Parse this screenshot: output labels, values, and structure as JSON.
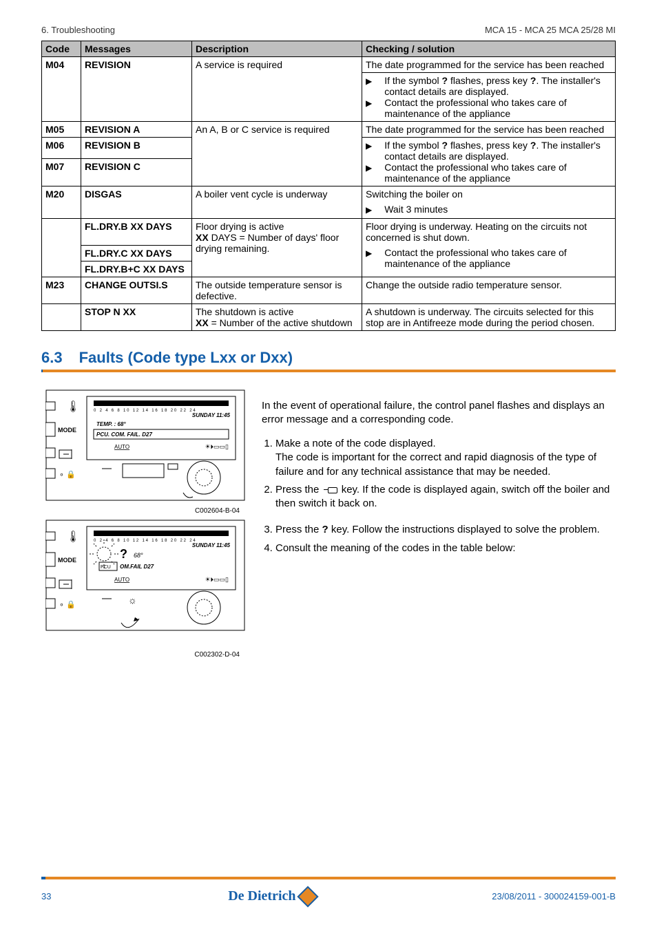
{
  "header": {
    "left": "6. Troubleshooting",
    "right": "MCA 15 - MCA 25 MCA 25/28 MI"
  },
  "table": {
    "headers": {
      "code": "Code",
      "messages": "Messages",
      "description": "Description",
      "checking": "Checking / solution"
    },
    "m04": {
      "code": "M04",
      "msg": "REVISION",
      "desc": "A service is required",
      "chk_main": "The date programmed for the service has been reached",
      "chk_b1a": "If the symbol ",
      "chk_b1b": " flashes, press key ",
      "chk_b1c": ". The installer's contact details are displayed.",
      "q1": "?",
      "q2": "?",
      "chk_b2": "Contact the professional who takes care of maintenance of the appliance"
    },
    "m05": {
      "code": "M05",
      "msg": "REVISION A"
    },
    "m06": {
      "code": "M06",
      "msg": "REVISION B"
    },
    "m07": {
      "code": "M07",
      "msg": "REVISION C"
    },
    "m0507": {
      "desc": "An A, B or C service is required",
      "chk_main": "The date programmed for the service has been reached",
      "chk_b1a": "If the symbol ",
      "chk_b1b": " flashes, press key ",
      "chk_b1c": ". The installer's contact details are displayed.",
      "q1": "?",
      "q2": "?",
      "chk_b2": "Contact the professional who takes care of maintenance of the appliance"
    },
    "m20": {
      "code": "M20",
      "msg": "DISGAS",
      "desc": "A boiler vent cycle is underway",
      "chk_main": "Switching the boiler on",
      "chk_b1": "Wait 3 minutes"
    },
    "fldry": {
      "msg1": "FL.DRY.B XX DAYS",
      "msg2": "FL.DRY.C XX DAYS",
      "msg3": "FL.DRY.B+C XX DAYS",
      "desc_l1": "Floor drying is active",
      "desc_l2a": "XX",
      "desc_l2b": " DAYS = Number of days' floor drying remaining.",
      "chk_main": "Floor drying is underway. Heating on the circuits not concerned is shut down.",
      "chk_b1": "Contact the professional who takes care of maintenance of the appliance"
    },
    "m23": {
      "code": "M23",
      "msg": "CHANGE OUTSI.S",
      "desc": "The outside temperature sensor is defective.",
      "chk": "Change the outside radio temperature sensor."
    },
    "stop": {
      "msg": "STOP N XX",
      "desc_l1": "The shutdown is active",
      "desc_l2a": "XX",
      "desc_l2b": " = Number of the active shutdown",
      "chk": "A shutdown is underway. The circuits selected for this stop are in Antifreeze mode during the period chosen."
    }
  },
  "section": {
    "num": "6.3",
    "title": "Faults (Code type Lxx or Dxx)"
  },
  "body": {
    "intro": "In the event of operational failure, the control panel flashes and displays an error message and a corresponding code.",
    "step1a": "Make a note of the code displayed.",
    "step1b": "The code is important for the correct and rapid diagnosis of the type of failure and for any technical assistance that may be needed.",
    "step2a": "Press the ",
    "step2b": " key. If the code is displayed again, switch off the boiler and then switch it back on.",
    "step3a": "Press the ",
    "step3q": "?",
    "step3b": " key. Follow the instructions displayed to solve the problem.",
    "step4": "Consult the meaning of the codes in the table below:"
  },
  "panel": {
    "bar_ticks": "0  2  4  6  8  10  12  14  16  18  20  22  24",
    "time": "SUNDAY 11:45",
    "temp": "TEMP. : 68°",
    "line1": "PCU. COM. FAIL.  D27",
    "auto": "AUTO",
    "icons": "☀ ⏵ ▭ ▭ ▯",
    "mode": "MODE",
    "fail_line": "OM.FAIL D27",
    "temp2": "68°"
  },
  "captions": {
    "c1": "C002604-B-04",
    "c2": "C002302-D-04"
  },
  "footer": {
    "page": "33",
    "brand": "De Dietrich",
    "doc": "23/08/2011 - 300024159-001-B"
  }
}
